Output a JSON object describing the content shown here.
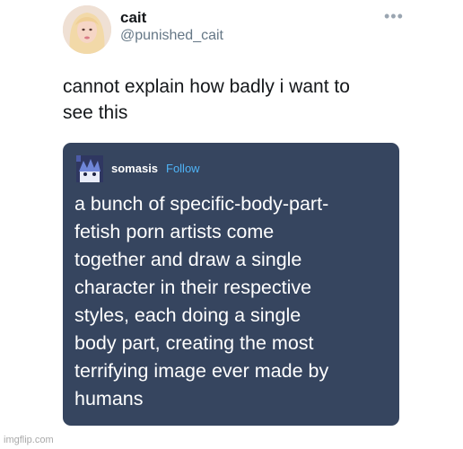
{
  "tweet": {
    "display_name": "cait",
    "handle": "@punished_cait",
    "more_icon": "ellipsis-icon",
    "text_lines": [
      "cannot explain how badly i want to",
      "see this"
    ]
  },
  "embedded_post": {
    "username": "somasis",
    "follow_label": "Follow",
    "body_lines": [
      "a bunch of specific-body-part-",
      "fetish porn artists come",
      "together and draw a single",
      "character in their respective",
      "styles, each doing a single",
      "body part, creating  the most",
      "terrifying image ever made by",
      "humans"
    ],
    "colors": {
      "card_background": "#36455f",
      "follow_link": "#4fb3f6",
      "text": "#ffffff"
    }
  },
  "watermark": "imgflip.com"
}
